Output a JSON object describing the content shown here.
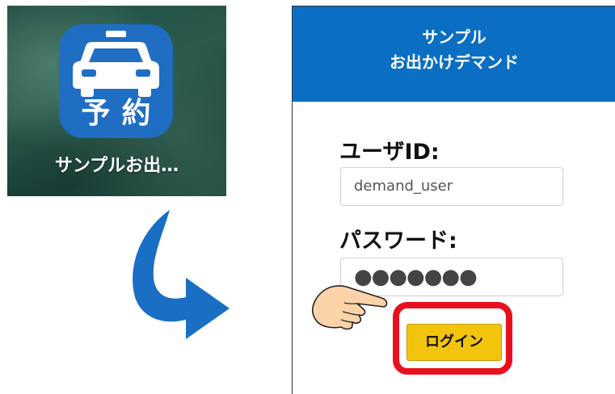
{
  "home_screen": {
    "app_icon_text": "予約",
    "app_label": "サンプルお出…"
  },
  "login_screen": {
    "header_line1": "サンプル",
    "header_line2": "お出かけデマンド",
    "user_label": "ユーザID:",
    "user_value": "demand_user",
    "password_label": "パスワード:",
    "password_value": "●●●●●●●",
    "login_button": "ログイン"
  },
  "colors": {
    "header": "#0a6fc2",
    "login_button": "#f2c40e",
    "highlight": "#e8101c",
    "app_icon": "#1f6ec4",
    "arrow": "#1a6fc4"
  },
  "icons": [
    "taxi-icon",
    "curved-arrow-icon",
    "pointing-hand-icon"
  ]
}
